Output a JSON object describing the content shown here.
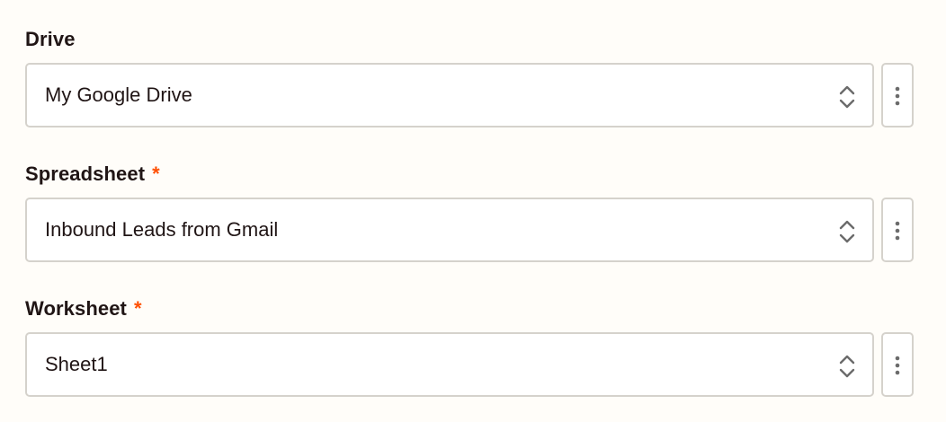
{
  "fields": [
    {
      "label": "Drive",
      "required": false,
      "value": "My Google Drive"
    },
    {
      "label": "Spreadsheet",
      "required": true,
      "required_mark": "*",
      "value": "Inbound Leads from Gmail"
    },
    {
      "label": "Worksheet",
      "required": true,
      "required_mark": "*",
      "value": "Sheet1"
    }
  ],
  "icons": {
    "select_indicator": "chevron-updown-icon",
    "options_button": "more-vertical-icon"
  },
  "colors": {
    "background": "#fffdf9",
    "text": "#201515",
    "required": "#ff4f00",
    "border": "#d5d2cc",
    "icon": "#6b6b6b"
  }
}
